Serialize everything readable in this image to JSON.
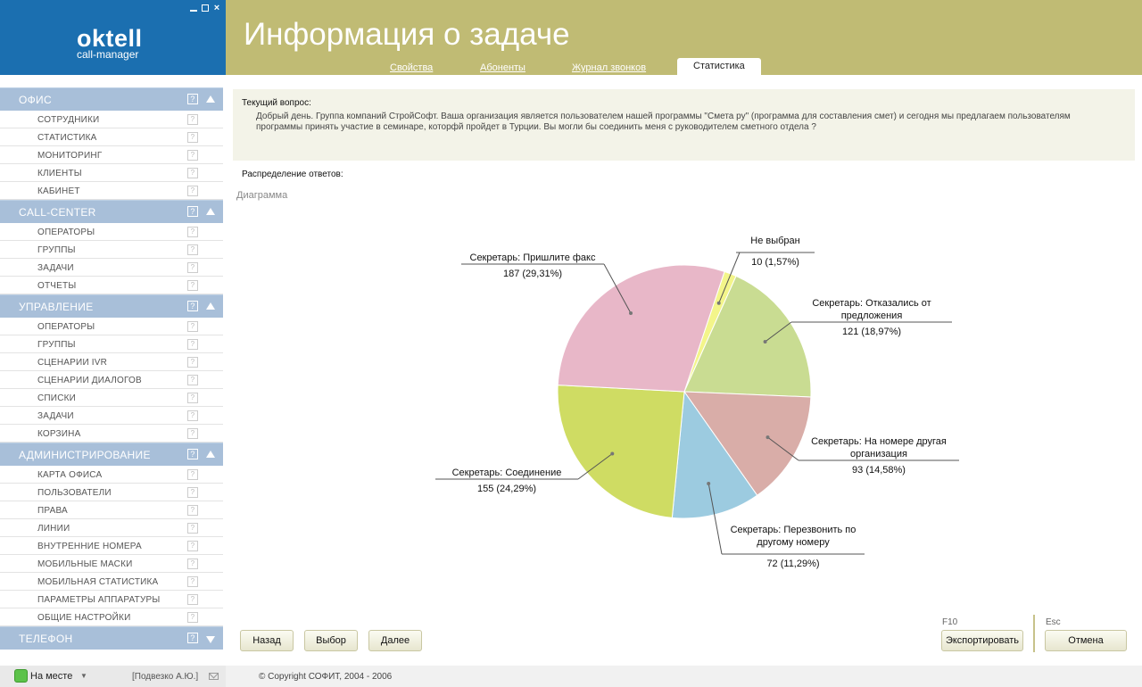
{
  "app": {
    "brand": "oktell",
    "brand_sub": "call-manager"
  },
  "header": {
    "title": "Информация о задаче",
    "tabs": [
      {
        "label": "Свойства",
        "active": false
      },
      {
        "label": "Абоненты",
        "active": false
      },
      {
        "label": "Журнал звонков",
        "active": false
      },
      {
        "label": "Статистика",
        "active": true
      }
    ]
  },
  "sidebar": {
    "sections": [
      {
        "title": "ОФИС",
        "expanded": true,
        "items": [
          "СОТРУДНИКИ",
          "СТАТИСТИКА",
          "МОНИТОРИНГ",
          "КЛИЕНТЫ",
          "КАБИНЕТ"
        ]
      },
      {
        "title": "CALL-CENTER",
        "expanded": true,
        "items": [
          "ОПЕРАТОРЫ",
          "ГРУППЫ",
          "ЗАДАЧИ",
          "ОТЧЕТЫ"
        ]
      },
      {
        "title": "УПРАВЛЕНИЕ",
        "expanded": true,
        "items": [
          "ОПЕРАТОРЫ",
          "ГРУППЫ",
          "СЦЕНАРИИ IVR",
          "СЦЕНАРИИ ДИАЛОГОВ",
          "СПИСКИ",
          "ЗАДАЧИ",
          "КОРЗИНА"
        ]
      },
      {
        "title": "АДМИНИСТРИРОВАНИЕ",
        "expanded": true,
        "items": [
          "КАРТА ОФИСА",
          "ПОЛЬЗОВАТЕЛИ",
          "ПРАВА",
          "ЛИНИИ",
          "ВНУТРЕННИЕ НОМЕРА",
          "МОБИЛЬНЫЕ МАСКИ",
          "МОБИЛЬНАЯ СТАТИСТИКА",
          "ПАРАМЕТРЫ АППАРАТУРЫ",
          "ОБЩИЕ НАСТРОЙКИ"
        ]
      },
      {
        "title": "ТЕЛЕФОН",
        "expanded": false,
        "items": []
      }
    ],
    "help_glyph": "?"
  },
  "main": {
    "question_label": "Текущий вопрос:",
    "question_text": "Добрый день. Группа компаний СтройСофт.  Ваша организация является пользователем нашей программы \"Смета ру\" (программа для составления смет) и сегодня мы предлагаем пользователям программы принять участие в семинаре, которфй пройдет в Турции. Вы могли бы соединить меня с  руководителем сметного отдела ?",
    "distribution_label": "Распределение ответов:",
    "diagram_label": "Диаграмма"
  },
  "chart_data": {
    "type": "pie",
    "slices": [
      {
        "label": [
          "Не выбран"
        ],
        "value": 10,
        "percent": "1,57%",
        "color": "#f3f58a"
      },
      {
        "label": [
          "Секретарь: Отказались от",
          "предложения"
        ],
        "value": 121,
        "percent": "18,97%",
        "color": "#c9dc92"
      },
      {
        "label": [
          "Секретарь: На номере другая",
          "организация"
        ],
        "value": 93,
        "percent": "14,58%",
        "color": "#d9ada8"
      },
      {
        "label": [
          "Секретарь: Перезвонить по",
          "другому номеру"
        ],
        "value": 72,
        "percent": "11,29%",
        "color": "#9ccbe0"
      },
      {
        "label": [
          "Секретарь: Соединение"
        ],
        "value": 155,
        "percent": "24,29%",
        "color": "#cfdc63"
      },
      {
        "label": [
          "Секретарь: Пришлите факс"
        ],
        "value": 187,
        "percent": "29,31%",
        "color": "#e8b7c8"
      }
    ]
  },
  "buttons": {
    "back": "Назад",
    "select": "Выбор",
    "next": "Далее",
    "export": "Экспортировать",
    "export_hint": "F10",
    "cancel": "Отмена",
    "cancel_hint": "Esc"
  },
  "footer": {
    "status": "На месте",
    "status_color": "#5cc24a",
    "user": "[Подвезко А.Ю.]",
    "copyright": "© Copyright СОФИТ, 2004 - 2006"
  },
  "colors": {
    "brand_blue": "#1b6fb0",
    "header_olive": "#c0bb74",
    "sidebar_header": "#a8bfd9"
  }
}
